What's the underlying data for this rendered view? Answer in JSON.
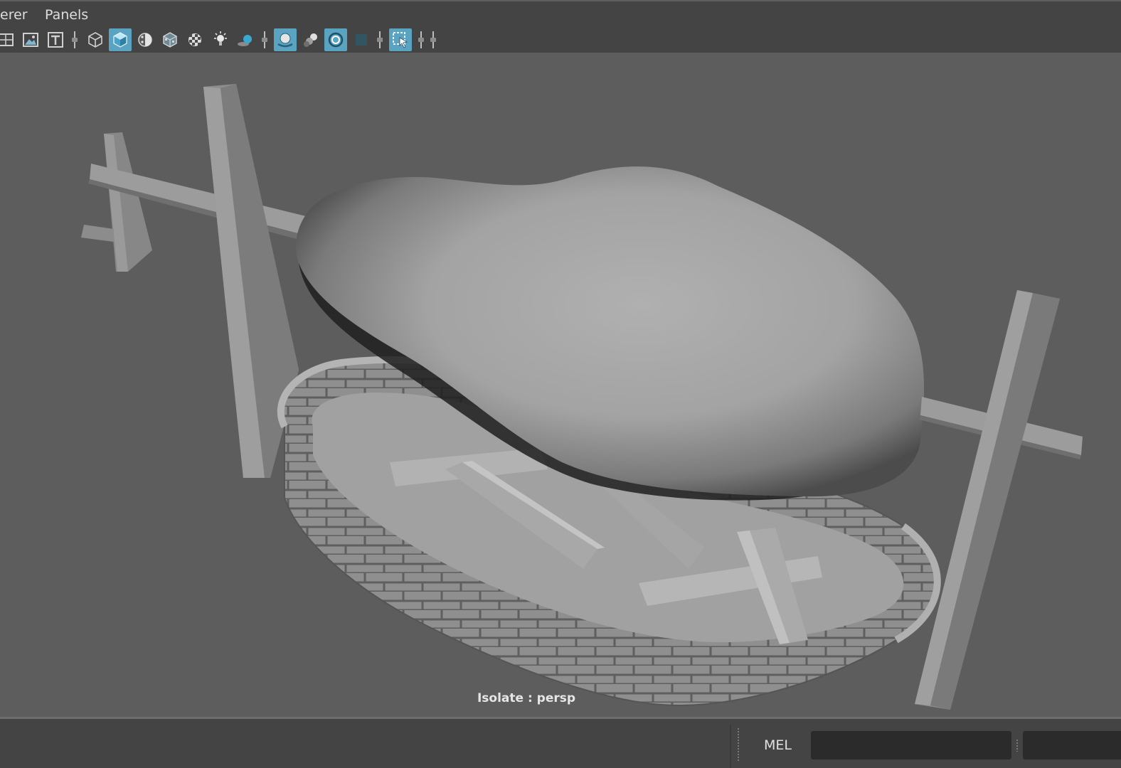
{
  "menubar": {
    "items": [
      "erer",
      "Panels"
    ]
  },
  "toolbar": {
    "icons": [
      "grid-icon",
      "image-plane-icon",
      "text-icon",
      "wireframe-cube-icon",
      "smooth-shade-cube-icon",
      "shade-ball-icon",
      "textured-cube-icon",
      "checker-icon",
      "light-bulb-icon",
      "shadow-sphere-icon",
      "ambient-occlusion-icon",
      "motion-blur-icon",
      "anti-alias-icon",
      "xray-icon",
      "isolate-select-icon"
    ],
    "active": [
      "smooth-shade-cube-icon",
      "ambient-occlusion-icon",
      "anti-alias-icon",
      "isolate-select-icon"
    ]
  },
  "viewport": {
    "hud": "Isolate : persp"
  },
  "command_line": {
    "language": "MEL",
    "value": "",
    "placeholder": ""
  },
  "colors": {
    "accent": "#5aa4c2",
    "viewport_bg": "#5d5d5d",
    "panel_bg": "#444444",
    "field_bg": "#2b2b2b"
  }
}
